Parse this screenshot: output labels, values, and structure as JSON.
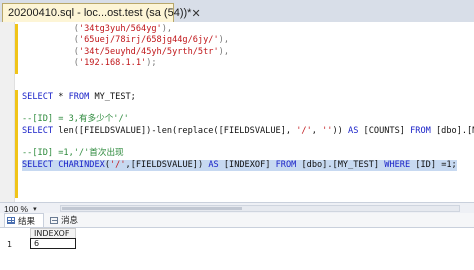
{
  "tab": {
    "title": "20200410.sql - loc...ost.test (sa (54))*",
    "close": "✕"
  },
  "editor": {
    "lines": [
      {
        "indent": "          ",
        "parts": [
          {
            "cls": "gray",
            "text": "("
          },
          {
            "cls": "str",
            "text": "'34tg3yuh/564yg'"
          },
          {
            "cls": "gray",
            "text": "),"
          }
        ]
      },
      {
        "indent": "          ",
        "parts": [
          {
            "cls": "gray",
            "text": "("
          },
          {
            "cls": "str",
            "text": "'65uej/78irj/658jg44g/6jy/'"
          },
          {
            "cls": "gray",
            "text": "),"
          }
        ]
      },
      {
        "indent": "          ",
        "parts": [
          {
            "cls": "gray",
            "text": "("
          },
          {
            "cls": "str",
            "text": "'34t/5euyhd/45yh/5yrth/5tr'"
          },
          {
            "cls": "gray",
            "text": "),"
          }
        ]
      },
      {
        "indent": "          ",
        "parts": [
          {
            "cls": "gray",
            "text": "("
          },
          {
            "cls": "str",
            "text": "'192.168.1.1'"
          },
          {
            "cls": "gray",
            "text": ");"
          }
        ]
      },
      {
        "indent": "",
        "parts": []
      },
      {
        "indent": "",
        "parts": []
      },
      {
        "indent": "",
        "parts": [
          {
            "cls": "kw",
            "text": "SELECT"
          },
          {
            "cls": "",
            "text": " * "
          },
          {
            "cls": "kw",
            "text": "FROM"
          },
          {
            "cls": "",
            "text": " MY_TEST;"
          }
        ]
      },
      {
        "indent": "",
        "parts": []
      },
      {
        "indent": "",
        "parts": [
          {
            "cls": "cmt",
            "text": "--[ID] = 3,有多少个'/'"
          }
        ]
      },
      {
        "indent": "",
        "parts": [
          {
            "cls": "kw",
            "text": "SELECT"
          },
          {
            "cls": "",
            "text": " len([FIELDSVALUE])-len(replace([FIELDSVALUE], "
          },
          {
            "cls": "str",
            "text": "'/'"
          },
          {
            "cls": "",
            "text": ", "
          },
          {
            "cls": "str",
            "text": "''"
          },
          {
            "cls": "",
            "text": ")) "
          },
          {
            "cls": "kw",
            "text": "AS"
          },
          {
            "cls": "",
            "text": " [COUNTS] "
          },
          {
            "cls": "kw",
            "text": "FROM"
          },
          {
            "cls": "",
            "text": " [dbo].[MY_TEST]"
          }
        ]
      },
      {
        "indent": "",
        "parts": []
      },
      {
        "indent": "",
        "parts": [
          {
            "cls": "cmt",
            "text": "--[ID] =1,'/'首次出现"
          }
        ]
      },
      {
        "indent": "",
        "highlight": true,
        "parts": [
          {
            "cls": "kw",
            "text": "SELECT"
          },
          {
            "cls": "",
            "text": " "
          },
          {
            "cls": "kw",
            "text": "CHARINDEX"
          },
          {
            "cls": "",
            "text": "("
          },
          {
            "cls": "str",
            "text": "'/'"
          },
          {
            "cls": "",
            "text": ",[FIELDSVALUE]) "
          },
          {
            "cls": "kw",
            "text": "AS"
          },
          {
            "cls": "",
            "text": " [INDEXOF] "
          },
          {
            "cls": "kw",
            "text": "FROM"
          },
          {
            "cls": "",
            "text": " [dbo].[MY_TEST] "
          },
          {
            "cls": "kw",
            "text": "WHERE"
          },
          {
            "cls": "",
            "text": " [ID] =1;"
          }
        ]
      }
    ]
  },
  "zoom": {
    "value": "100 %",
    "dropdown": "▾"
  },
  "results_tabs": {
    "results": "结果",
    "messages": "消息"
  },
  "grid": {
    "columns": [
      "INDEXOF"
    ],
    "rows": [
      {
        "num": "1",
        "values": [
          "6"
        ]
      }
    ]
  }
}
